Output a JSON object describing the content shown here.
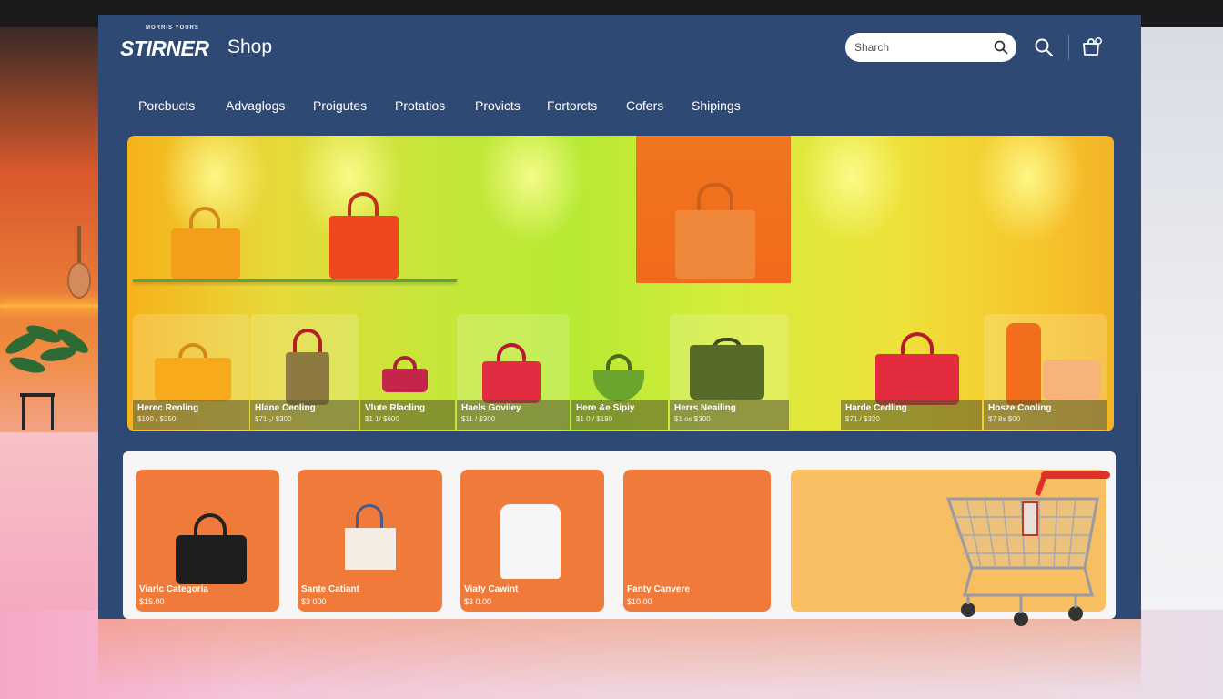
{
  "brand": {
    "kicker": "MORRIS YOURS",
    "logo": "STIRNER",
    "section": "Shop"
  },
  "search": {
    "placeholder": "Sharch"
  },
  "nav": {
    "items": [
      "Porcbucts",
      "Advaglogs",
      "Proigutes",
      "Protatios",
      "Provicts",
      "Fortorcts",
      "Cofers",
      "Shipings"
    ]
  },
  "products": [
    {
      "name": "Herec Reoling",
      "price": "$100 / $350"
    },
    {
      "name": "Hlane Ceoling",
      "price": "$71 ₁/ $300"
    },
    {
      "name": "Vlute Rlacling",
      "price": "$1 1/ $600"
    },
    {
      "name": "Haels Goviley",
      "price": "$11 / $300"
    },
    {
      "name": "Here &e Sipiy",
      "price": "$1 0 / $180"
    },
    {
      "name": "Herrs Neailing",
      "price": "$1 os $300"
    },
    {
      "name": "Harde Cedling",
      "price": "$71 / $330"
    },
    {
      "name": "Hosze Cooling",
      "price": "$7 8s $00"
    }
  ],
  "categories": [
    {
      "name": "Viarlc Categoria",
      "price": "$15.00"
    },
    {
      "name": "Sante Catiant",
      "price": "$3 000"
    },
    {
      "name": "Viaty Cawint",
      "price": "$3 0.00"
    },
    {
      "name": "Fanty Canvere",
      "price": "$10 00"
    }
  ],
  "colors": {
    "header": "#2e4a74",
    "accent_orange": "#f07a3a",
    "promo": "#f8bf62"
  },
  "icons": [
    "search-icon",
    "cart-icon",
    "shopping-cart-icon"
  ]
}
